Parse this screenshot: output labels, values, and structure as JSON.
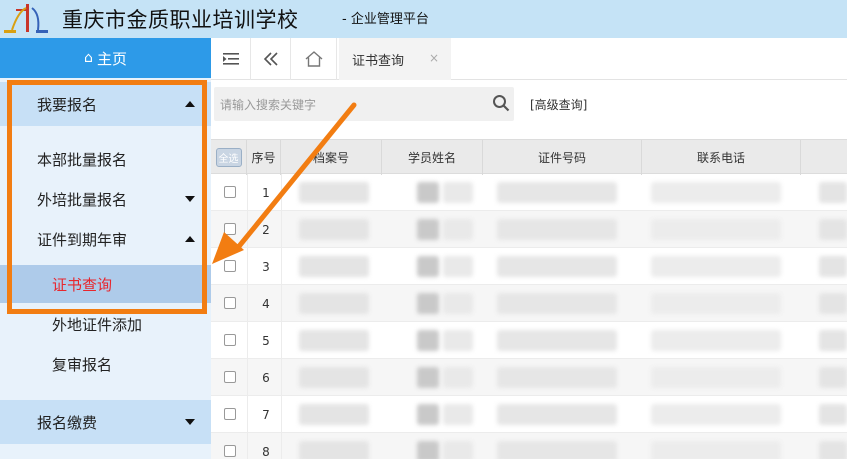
{
  "header": {
    "title": "重庆市金质职业培训学校",
    "subtitle": "- 企业管理平台"
  },
  "sidebar": {
    "home_label": "主页",
    "items": [
      {
        "label": "我要报名",
        "level": 1,
        "caret": "up"
      },
      {
        "label": "本部批量报名",
        "level": 1,
        "caret": "none"
      },
      {
        "label": "外培批量报名",
        "level": 1,
        "caret": "down"
      },
      {
        "label": "证件到期年审",
        "level": 1,
        "caret": "up"
      },
      {
        "label": "证书查询",
        "level": 2,
        "caret": "none",
        "active": true
      },
      {
        "label": "外地证件添加",
        "level": 2,
        "caret": "none"
      },
      {
        "label": "复审报名",
        "level": 2,
        "caret": "none"
      },
      {
        "label": "报名缴费",
        "level": 1,
        "caret": "down"
      }
    ]
  },
  "tabbar": {
    "active_tab": "证书查询",
    "close_glyph": "×",
    "collapse_icon": "menu-fold-icon",
    "back_icon": "double-chevron-left-icon",
    "home_icon": "home-icon"
  },
  "search": {
    "placeholder": "请输入搜索关键字",
    "advanced_label": "[高级查询]"
  },
  "table": {
    "select_all_label": "全选",
    "headers": [
      "序号",
      "档案号",
      "学员姓名",
      "证件号码",
      "联系电话"
    ],
    "rows": [
      "1",
      "2",
      "3",
      "4",
      "5",
      "6",
      "7",
      "8"
    ]
  },
  "colors": {
    "header_bg": "#c5e3f6",
    "home_btn": "#2d9ae8",
    "active_menu_text": "#e8262d",
    "annotation": "#f27d12"
  }
}
